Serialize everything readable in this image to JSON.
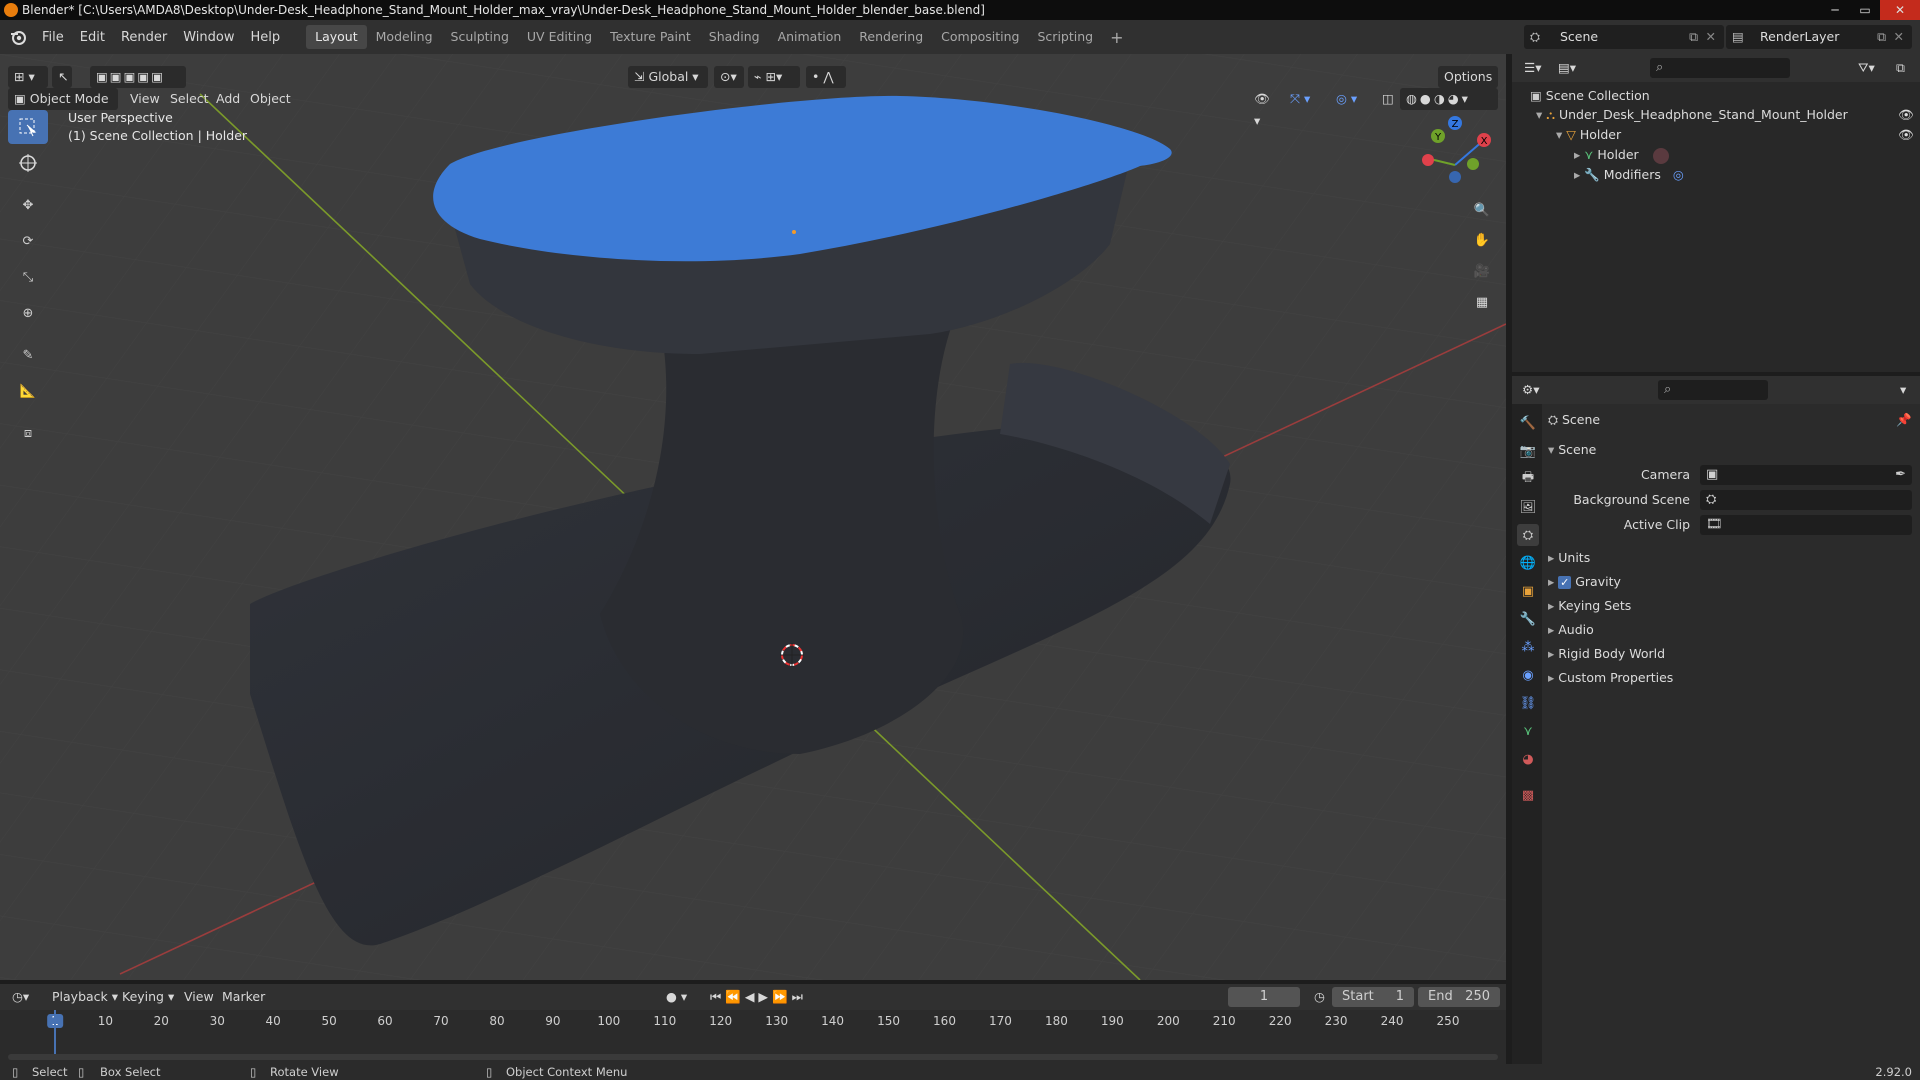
{
  "window": {
    "title": "Blender* [C:\\Users\\AMDA8\\Desktop\\Under-Desk_Headphone_Stand_Mount_Holder_max_vray\\Under-Desk_Headphone_Stand_Mount_Holder_blender_base.blend]",
    "controls": [
      "─",
      "▭",
      "✕"
    ]
  },
  "menu": [
    "File",
    "Edit",
    "Render",
    "Window",
    "Help"
  ],
  "workspaces": [
    "Layout",
    "Modeling",
    "Sculpting",
    "UV Editing",
    "Texture Paint",
    "Shading",
    "Animation",
    "Rendering",
    "Compositing",
    "Scripting"
  ],
  "active_workspace": "Layout",
  "scene_selector": "Scene",
  "view_layer": "RenderLayer",
  "viewport": {
    "mode": "Object Mode",
    "menus": [
      "View",
      "Select",
      "Add",
      "Object"
    ],
    "orientation": "Global",
    "options": "Options",
    "perspective": "User Perspective",
    "collection_info": "(1) Scene Collection | Holder",
    "gizmo_axes": {
      "x": "X",
      "y": "Y",
      "z": "Z"
    },
    "colors": {
      "top_face": "#3d7bd6",
      "body": "#2f3238",
      "x_axis": "#9a3d3d",
      "y_axis": "#7b9a2a"
    }
  },
  "outliner": {
    "root": "Scene Collection",
    "items": [
      {
        "label": "Under_Desk_Headphone_Stand_Mount_Holder",
        "depth": 1
      },
      {
        "label": "Holder",
        "depth": 2
      },
      {
        "label": "Holder",
        "depth": 3
      },
      {
        "label": "Modifiers",
        "depth": 3
      }
    ]
  },
  "properties": {
    "context": "Scene",
    "panel": "Scene",
    "fields": [
      {
        "label": "Camera",
        "value": ""
      },
      {
        "label": "Background Scene",
        "value": ""
      },
      {
        "label": "Active Clip",
        "value": ""
      }
    ],
    "sections": [
      "Units",
      "Gravity",
      "Keying Sets",
      "Audio",
      "Rigid Body World",
      "Custom Properties"
    ],
    "gravity_checked": true
  },
  "timeline": {
    "menus": [
      "Playback",
      "Keying",
      "View",
      "Marker"
    ],
    "current_frame": "1",
    "start_label": "Start",
    "start": "1",
    "end_label": "End",
    "end": "250",
    "ticks": [
      "1",
      "10",
      "20",
      "30",
      "40",
      "50",
      "60",
      "70",
      "80",
      "90",
      "100",
      "110",
      "120",
      "130",
      "140",
      "150",
      "160",
      "170",
      "180",
      "190",
      "200",
      "210",
      "220",
      "230",
      "240",
      "250"
    ]
  },
  "statusbar": {
    "select": "Select",
    "box_select": "Box Select",
    "rotate": "Rotate View",
    "context_menu": "Object Context Menu",
    "version": "2.92.0"
  }
}
